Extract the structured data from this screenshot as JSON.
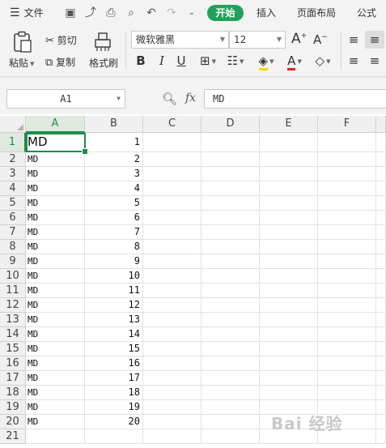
{
  "menubar": {
    "file_label": "文件",
    "tabs": [
      {
        "label": "开始",
        "active": true
      },
      {
        "label": "插入",
        "active": false
      },
      {
        "label": "页面布局",
        "active": false
      },
      {
        "label": "公式",
        "active": false
      }
    ]
  },
  "ribbon": {
    "paste_label": "粘贴",
    "cut_label": "剪切",
    "copy_label": "复制",
    "format_painter_label": "格式刷",
    "font_name": "微软雅黑",
    "font_size": "12"
  },
  "formula_bar": {
    "name_box": "A1",
    "fx_label": "fx",
    "content": "MD"
  },
  "grid": {
    "columns": [
      "A",
      "B",
      "C",
      "D",
      "E",
      "F"
    ],
    "selected_column": "A",
    "selected_row": "1",
    "rows": [
      {
        "num": "1",
        "a": "MD",
        "b": "1"
      },
      {
        "num": "2",
        "a": "MD",
        "b": "2"
      },
      {
        "num": "3",
        "a": "MD",
        "b": "3"
      },
      {
        "num": "4",
        "a": "MD",
        "b": "4"
      },
      {
        "num": "5",
        "a": "MD",
        "b": "5"
      },
      {
        "num": "6",
        "a": "MD",
        "b": "6"
      },
      {
        "num": "7",
        "a": "MD",
        "b": "7"
      },
      {
        "num": "8",
        "a": "MD",
        "b": "8"
      },
      {
        "num": "9",
        "a": "MD",
        "b": "9"
      },
      {
        "num": "10",
        "a": "MD",
        "b": "10"
      },
      {
        "num": "11",
        "a": "MD",
        "b": "11"
      },
      {
        "num": "12",
        "a": "MD",
        "b": "12"
      },
      {
        "num": "13",
        "a": "MD",
        "b": "13"
      },
      {
        "num": "14",
        "a": "MD",
        "b": "14"
      },
      {
        "num": "15",
        "a": "MD",
        "b": "15"
      },
      {
        "num": "16",
        "a": "MD",
        "b": "16"
      },
      {
        "num": "17",
        "a": "MD",
        "b": "17"
      },
      {
        "num": "18",
        "a": "MD",
        "b": "18"
      },
      {
        "num": "19",
        "a": "MD",
        "b": "19"
      },
      {
        "num": "20",
        "a": "MD",
        "b": "20"
      },
      {
        "num": "21",
        "a": "",
        "b": ""
      }
    ]
  },
  "colors": {
    "accent_green": "#1fa35a",
    "selection_green": "#1f8a4c"
  },
  "watermark": "Bai 经验"
}
